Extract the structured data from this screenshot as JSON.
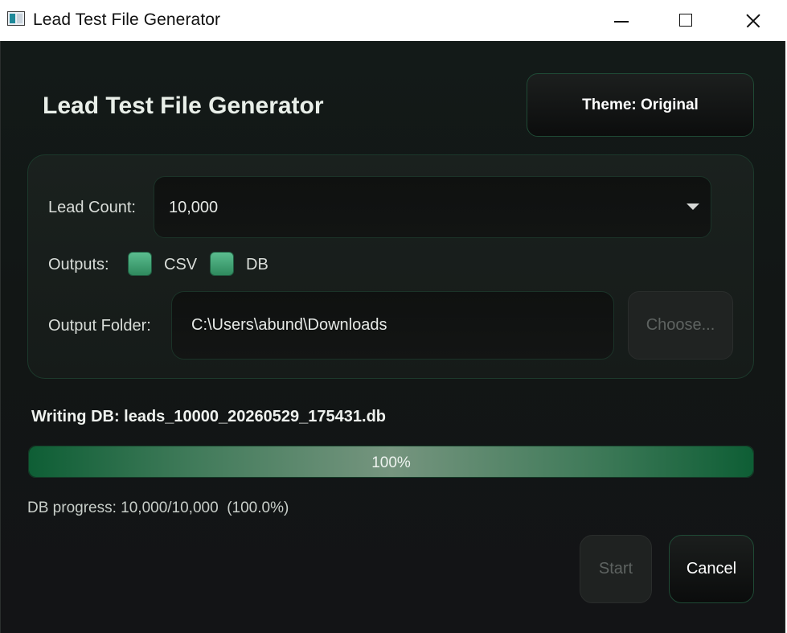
{
  "window": {
    "title": "Lead Test File Generator",
    "icon": "app-window-icon",
    "controls": [
      "minimize-icon",
      "maximize-icon",
      "close-icon"
    ]
  },
  "header": {
    "title": "Lead Test File Generator",
    "theme_button_label": "Theme: Original"
  },
  "settings": {
    "lead_count_label": "Lead Count:",
    "lead_count_value": "10,000",
    "outputs_label": "Outputs:",
    "outputs": [
      {
        "label": "CSV",
        "checked": true
      },
      {
        "label": "DB",
        "checked": true
      }
    ],
    "output_folder_label": "Output Folder:",
    "output_folder_value": "C:\\Users\\abund\\Downloads",
    "choose_button_label": "Choose..."
  },
  "status": {
    "message": "Writing DB: leads_10000_20260529_175431.db",
    "progress_percent": 100,
    "progress_text": "100%",
    "detail": "DB progress: 10,000/10,000  (100.0%)"
  },
  "actions": {
    "start_label": "Start",
    "start_enabled": false,
    "cancel_label": "Cancel"
  },
  "colors": {
    "accent": "#2f8a5e",
    "progress_green": "#0e5e35",
    "background": "#131615"
  }
}
